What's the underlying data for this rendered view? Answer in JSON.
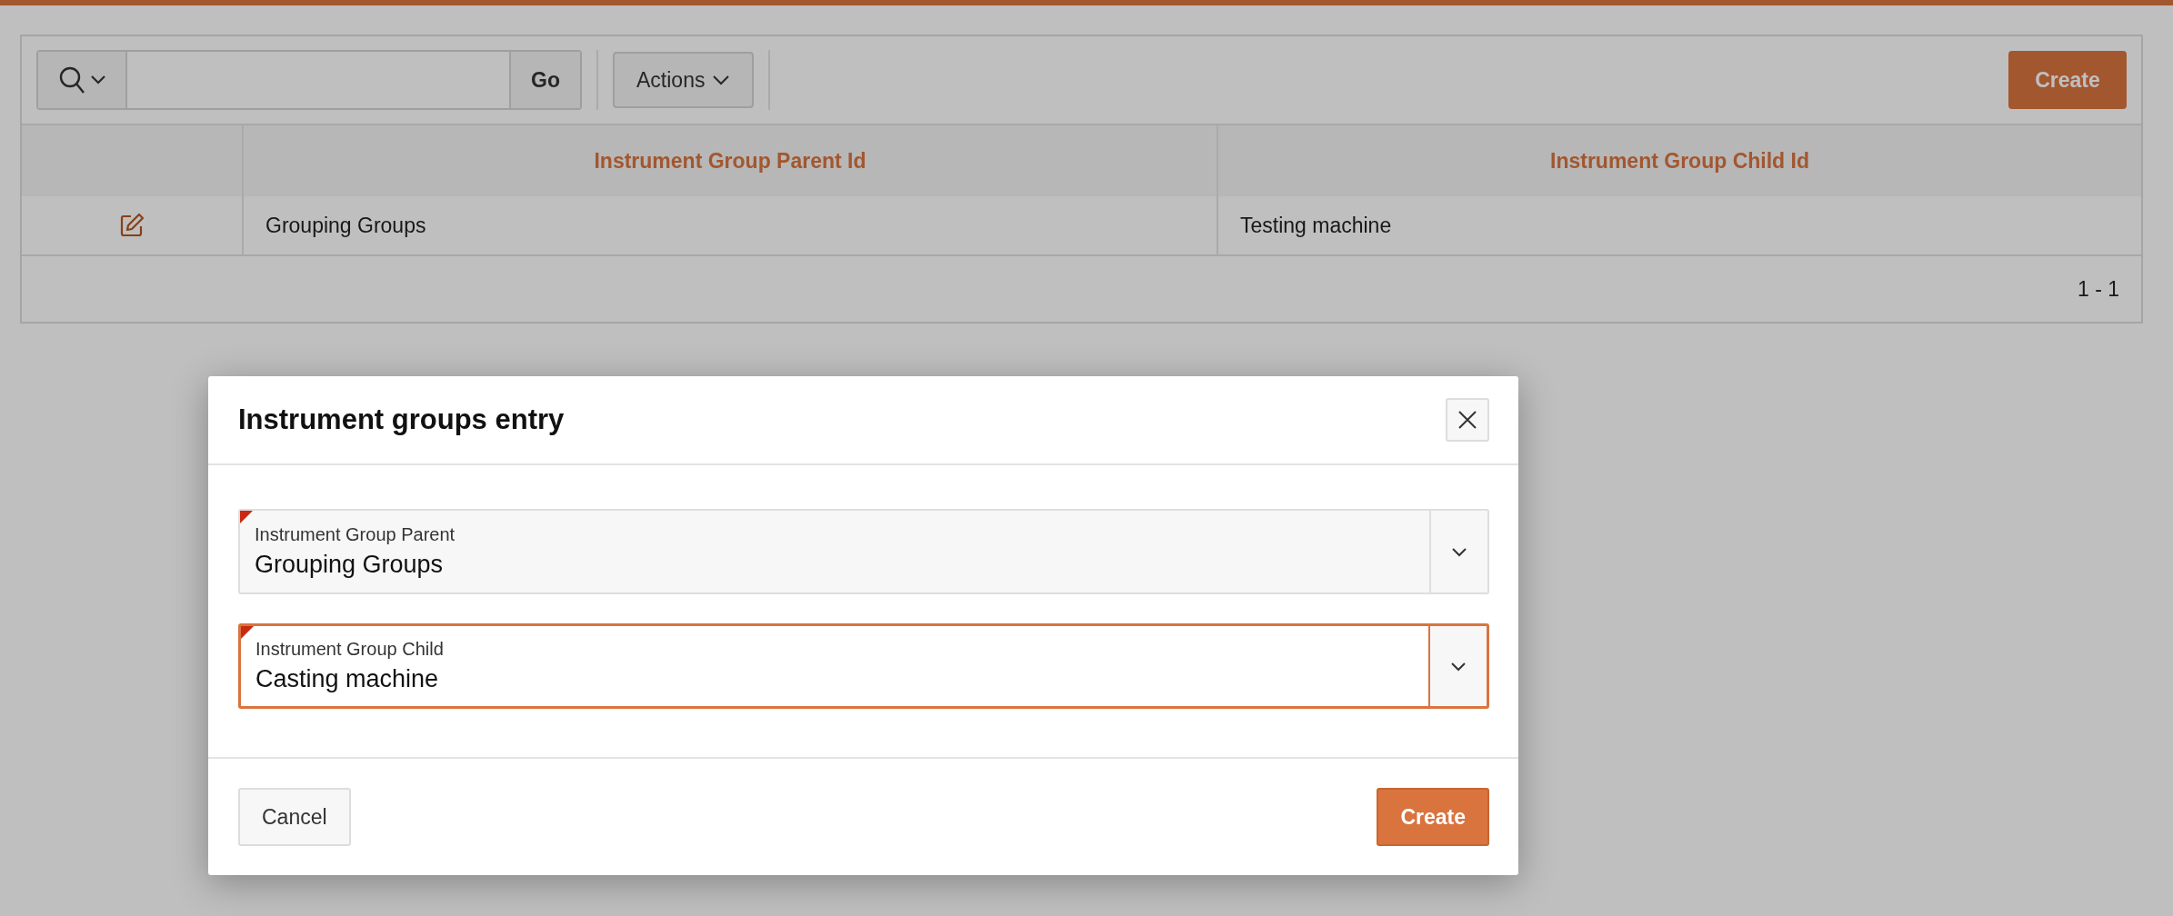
{
  "toolbar": {
    "go_button": "Go",
    "actions_button": "Actions",
    "create_button": "Create"
  },
  "table": {
    "columns": [
      "",
      "Instrument Group Parent Id",
      "Instrument Group Child Id"
    ],
    "rows": [
      {
        "cells": [
          "Grouping Groups",
          "Testing machine"
        ]
      }
    ],
    "pagination": "1 - 1"
  },
  "dialog": {
    "title": "Instrument groups entry",
    "fields": [
      {
        "label": "Instrument Group Parent",
        "value": "Grouping Groups",
        "required": true,
        "focused": false
      },
      {
        "label": "Instrument Group Child",
        "value": "Casting machine",
        "required": true,
        "focused": true
      }
    ],
    "buttons": [
      {
        "label": "Cancel",
        "kind": "secondary"
      },
      {
        "label": "Create",
        "kind": "primary"
      }
    ]
  }
}
